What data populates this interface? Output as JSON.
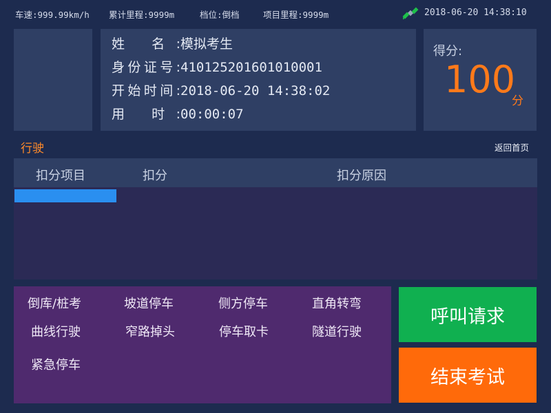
{
  "status_bar": {
    "speed": "车速:999.99km/h",
    "total_mileage": "累计里程:9999m",
    "gear": "档位:倒档",
    "project_mileage": "项目里程:9999m",
    "datetime": "2018-06-20 14:38:10"
  },
  "examinee": {
    "name_label": "姓 名:",
    "name": "模拟考生",
    "id_label": "身份证号:",
    "id_number": "410125201601010001",
    "start_label": "开始时间:",
    "start_time": "2018-06-20 14:38:02",
    "elapsed_label": "用 时:",
    "elapsed": "00:00:07"
  },
  "score": {
    "label": "得分:",
    "value": "100",
    "unit": "分"
  },
  "section": {
    "title": "行驶",
    "home_link": "返回首页"
  },
  "deduction_table": {
    "columns": [
      "扣分项目",
      "扣分",
      "扣分原因"
    ],
    "rows": []
  },
  "exam_items": [
    "倒库/桩考",
    "坡道停车",
    "侧方停车",
    "直角转弯",
    "曲线行驶",
    "窄路掉头",
    "停车取卡",
    "隧道行驶",
    "紧急停车"
  ],
  "actions": {
    "call_label": "呼叫请求",
    "end_label": "结束考试"
  },
  "colors": {
    "background": "#1d2b4f",
    "panel": "#2f3f64",
    "score": "#ff7a1a",
    "call_button": "#10b050",
    "end_button": "#ff6a0a",
    "selection": "#2a8ff0",
    "items_panel": "#4f2a6e"
  },
  "icons": {
    "gps": "satellite-icon"
  }
}
